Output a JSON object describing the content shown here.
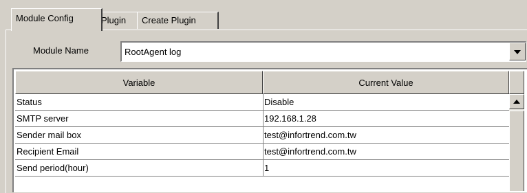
{
  "tabs": [
    {
      "label": "Module Config",
      "active": true
    },
    {
      "label": "Plugin",
      "active": false
    },
    {
      "label": "Create Plugin",
      "active": false
    }
  ],
  "module": {
    "label": "Module Name",
    "selected": "RootAgent log",
    "dropdown_icon": "chevron-down-icon"
  },
  "table": {
    "columns": [
      "Variable",
      "Current Value"
    ],
    "rows": [
      {
        "variable": "Status",
        "value": "Disable"
      },
      {
        "variable": "SMTP server",
        "value": "192.168.1.28"
      },
      {
        "variable": "Sender mail box",
        "value": "test@infortrend.com.tw"
      },
      {
        "variable": "Recipient Email",
        "value": "test@infortrend.com.tw"
      },
      {
        "variable": "Send period(hour)",
        "value": "1"
      }
    ]
  },
  "colors": {
    "window_bg": "#d4d0c8",
    "table_bg": "#ffffff"
  }
}
